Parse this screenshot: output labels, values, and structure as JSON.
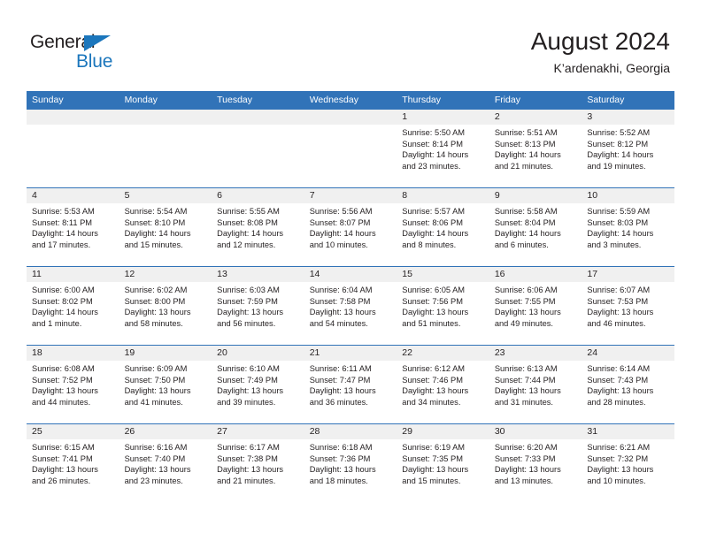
{
  "brand": {
    "name_part1": "General",
    "name_part2": "Blue",
    "accent_color": "#1b76bc",
    "triangle_icon": "triangle-icon"
  },
  "header": {
    "title": "August 2024",
    "subtitle": "K’ardenakhi, Georgia",
    "header_bg_color": "#3173b8",
    "daynum_bg_color": "#f0f0f0"
  },
  "weekday_headers": [
    "Sunday",
    "Monday",
    "Tuesday",
    "Wednesday",
    "Thursday",
    "Friday",
    "Saturday"
  ],
  "weeks": [
    [
      {
        "day": "",
        "lines": []
      },
      {
        "day": "",
        "lines": []
      },
      {
        "day": "",
        "lines": []
      },
      {
        "day": "",
        "lines": []
      },
      {
        "day": "1",
        "lines": [
          "Sunrise: 5:50 AM",
          "Sunset: 8:14 PM",
          "Daylight: 14 hours",
          "and 23 minutes."
        ]
      },
      {
        "day": "2",
        "lines": [
          "Sunrise: 5:51 AM",
          "Sunset: 8:13 PM",
          "Daylight: 14 hours",
          "and 21 minutes."
        ]
      },
      {
        "day": "3",
        "lines": [
          "Sunrise: 5:52 AM",
          "Sunset: 8:12 PM",
          "Daylight: 14 hours",
          "and 19 minutes."
        ]
      }
    ],
    [
      {
        "day": "4",
        "lines": [
          "Sunrise: 5:53 AM",
          "Sunset: 8:11 PM",
          "Daylight: 14 hours",
          "and 17 minutes."
        ]
      },
      {
        "day": "5",
        "lines": [
          "Sunrise: 5:54 AM",
          "Sunset: 8:10 PM",
          "Daylight: 14 hours",
          "and 15 minutes."
        ]
      },
      {
        "day": "6",
        "lines": [
          "Sunrise: 5:55 AM",
          "Sunset: 8:08 PM",
          "Daylight: 14 hours",
          "and 12 minutes."
        ]
      },
      {
        "day": "7",
        "lines": [
          "Sunrise: 5:56 AM",
          "Sunset: 8:07 PM",
          "Daylight: 14 hours",
          "and 10 minutes."
        ]
      },
      {
        "day": "8",
        "lines": [
          "Sunrise: 5:57 AM",
          "Sunset: 8:06 PM",
          "Daylight: 14 hours",
          "and 8 minutes."
        ]
      },
      {
        "day": "9",
        "lines": [
          "Sunrise: 5:58 AM",
          "Sunset: 8:04 PM",
          "Daylight: 14 hours",
          "and 6 minutes."
        ]
      },
      {
        "day": "10",
        "lines": [
          "Sunrise: 5:59 AM",
          "Sunset: 8:03 PM",
          "Daylight: 14 hours",
          "and 3 minutes."
        ]
      }
    ],
    [
      {
        "day": "11",
        "lines": [
          "Sunrise: 6:00 AM",
          "Sunset: 8:02 PM",
          "Daylight: 14 hours",
          "and 1 minute."
        ]
      },
      {
        "day": "12",
        "lines": [
          "Sunrise: 6:02 AM",
          "Sunset: 8:00 PM",
          "Daylight: 13 hours",
          "and 58 minutes."
        ]
      },
      {
        "day": "13",
        "lines": [
          "Sunrise: 6:03 AM",
          "Sunset: 7:59 PM",
          "Daylight: 13 hours",
          "and 56 minutes."
        ]
      },
      {
        "day": "14",
        "lines": [
          "Sunrise: 6:04 AM",
          "Sunset: 7:58 PM",
          "Daylight: 13 hours",
          "and 54 minutes."
        ]
      },
      {
        "day": "15",
        "lines": [
          "Sunrise: 6:05 AM",
          "Sunset: 7:56 PM",
          "Daylight: 13 hours",
          "and 51 minutes."
        ]
      },
      {
        "day": "16",
        "lines": [
          "Sunrise: 6:06 AM",
          "Sunset: 7:55 PM",
          "Daylight: 13 hours",
          "and 49 minutes."
        ]
      },
      {
        "day": "17",
        "lines": [
          "Sunrise: 6:07 AM",
          "Sunset: 7:53 PM",
          "Daylight: 13 hours",
          "and 46 minutes."
        ]
      }
    ],
    [
      {
        "day": "18",
        "lines": [
          "Sunrise: 6:08 AM",
          "Sunset: 7:52 PM",
          "Daylight: 13 hours",
          "and 44 minutes."
        ]
      },
      {
        "day": "19",
        "lines": [
          "Sunrise: 6:09 AM",
          "Sunset: 7:50 PM",
          "Daylight: 13 hours",
          "and 41 minutes."
        ]
      },
      {
        "day": "20",
        "lines": [
          "Sunrise: 6:10 AM",
          "Sunset: 7:49 PM",
          "Daylight: 13 hours",
          "and 39 minutes."
        ]
      },
      {
        "day": "21",
        "lines": [
          "Sunrise: 6:11 AM",
          "Sunset: 7:47 PM",
          "Daylight: 13 hours",
          "and 36 minutes."
        ]
      },
      {
        "day": "22",
        "lines": [
          "Sunrise: 6:12 AM",
          "Sunset: 7:46 PM",
          "Daylight: 13 hours",
          "and 34 minutes."
        ]
      },
      {
        "day": "23",
        "lines": [
          "Sunrise: 6:13 AM",
          "Sunset: 7:44 PM",
          "Daylight: 13 hours",
          "and 31 minutes."
        ]
      },
      {
        "day": "24",
        "lines": [
          "Sunrise: 6:14 AM",
          "Sunset: 7:43 PM",
          "Daylight: 13 hours",
          "and 28 minutes."
        ]
      }
    ],
    [
      {
        "day": "25",
        "lines": [
          "Sunrise: 6:15 AM",
          "Sunset: 7:41 PM",
          "Daylight: 13 hours",
          "and 26 minutes."
        ]
      },
      {
        "day": "26",
        "lines": [
          "Sunrise: 6:16 AM",
          "Sunset: 7:40 PM",
          "Daylight: 13 hours",
          "and 23 minutes."
        ]
      },
      {
        "day": "27",
        "lines": [
          "Sunrise: 6:17 AM",
          "Sunset: 7:38 PM",
          "Daylight: 13 hours",
          "and 21 minutes."
        ]
      },
      {
        "day": "28",
        "lines": [
          "Sunrise: 6:18 AM",
          "Sunset: 7:36 PM",
          "Daylight: 13 hours",
          "and 18 minutes."
        ]
      },
      {
        "day": "29",
        "lines": [
          "Sunrise: 6:19 AM",
          "Sunset: 7:35 PM",
          "Daylight: 13 hours",
          "and 15 minutes."
        ]
      },
      {
        "day": "30",
        "lines": [
          "Sunrise: 6:20 AM",
          "Sunset: 7:33 PM",
          "Daylight: 13 hours",
          "and 13 minutes."
        ]
      },
      {
        "day": "31",
        "lines": [
          "Sunrise: 6:21 AM",
          "Sunset: 7:32 PM",
          "Daylight: 13 hours",
          "and 10 minutes."
        ]
      }
    ]
  ]
}
